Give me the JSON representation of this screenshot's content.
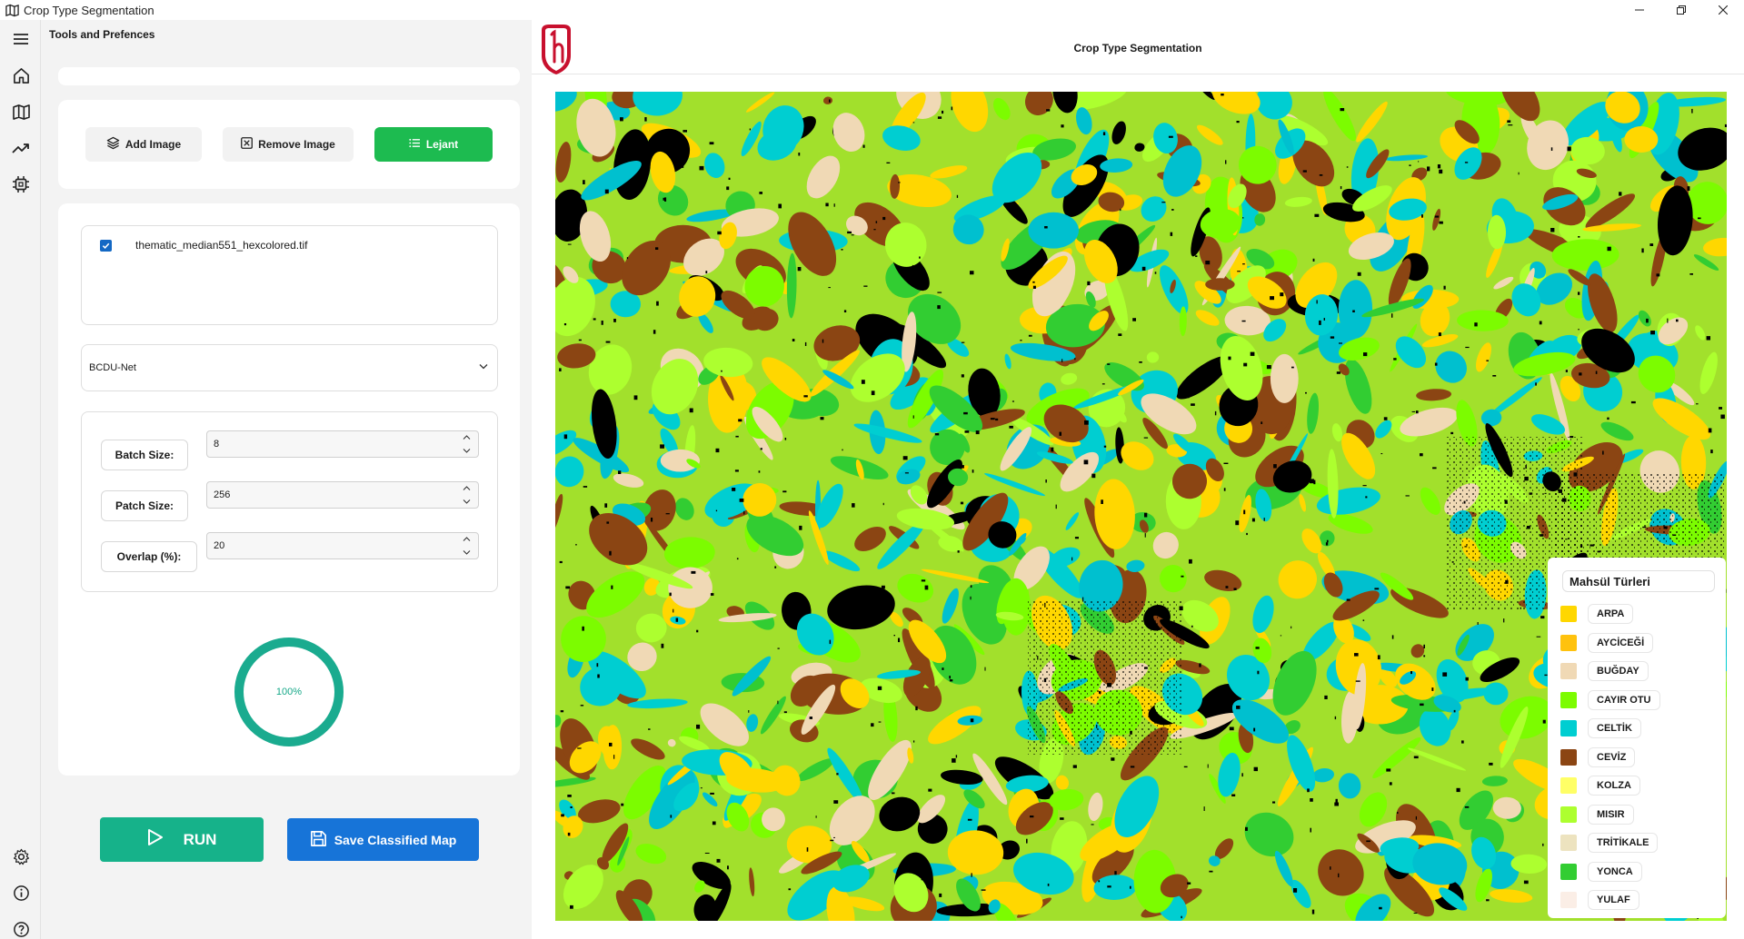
{
  "window": {
    "title": "Crop Type Segmentation",
    "controls": [
      "minimize",
      "maximize",
      "close"
    ]
  },
  "rail": {
    "top_icons": [
      "menu-icon",
      "home-icon",
      "map-icon",
      "trend-icon",
      "chip-icon"
    ],
    "bottom_icons": [
      "settings-icon",
      "info-icon",
      "help-icon"
    ]
  },
  "left_panel": {
    "header": "Tools and Prefences",
    "toolbar": {
      "add_image": "Add Image",
      "remove_image": "Remove Image",
      "legend": "Lejant",
      "legend_color": "#1dbb50"
    },
    "files": [
      {
        "name": "thematic_median551_hexcolored.tif",
        "checked": true
      }
    ],
    "model_select": {
      "value": "BCDU-Net"
    },
    "params": {
      "batch_size": {
        "label": "Batch Size:",
        "value": "8"
      },
      "patch_size": {
        "label": "Patch Size:",
        "value": "256"
      },
      "overlap": {
        "label": "Overlap (%):",
        "value": "20"
      }
    },
    "progress": {
      "value": 100,
      "text": "100%",
      "color": "#1aab8f"
    },
    "run_button": {
      "label": "RUN",
      "color": "#16b28a"
    },
    "save_button": {
      "label": "Save Classified Map",
      "color": "#1774d8"
    }
  },
  "right_panel": {
    "title": "Crop Type Segmentation",
    "legend": {
      "title": "Mahsül Türleri",
      "items": [
        {
          "label": "ARPA",
          "color": "#ffd700"
        },
        {
          "label": "AYCİCEĞİ",
          "color": "#ffc20e"
        },
        {
          "label": "BUĞDAY",
          "color": "#f0d9b5"
        },
        {
          "label": "CAYIR OTU",
          "color": "#7cfc00"
        },
        {
          "label": "CELTİK",
          "color": "#00ced1"
        },
        {
          "label": "CEVİZ",
          "color": "#8b4513"
        },
        {
          "label": "KOLZA",
          "color": "#ffff66"
        },
        {
          "label": "MISIR",
          "color": "#adff2f"
        },
        {
          "label": "TRİTİKALE",
          "color": "#ede3bf"
        },
        {
          "label": "YONCA",
          "color": "#32cd32"
        },
        {
          "label": "YULAF",
          "color": "#fbeee6"
        }
      ]
    }
  }
}
